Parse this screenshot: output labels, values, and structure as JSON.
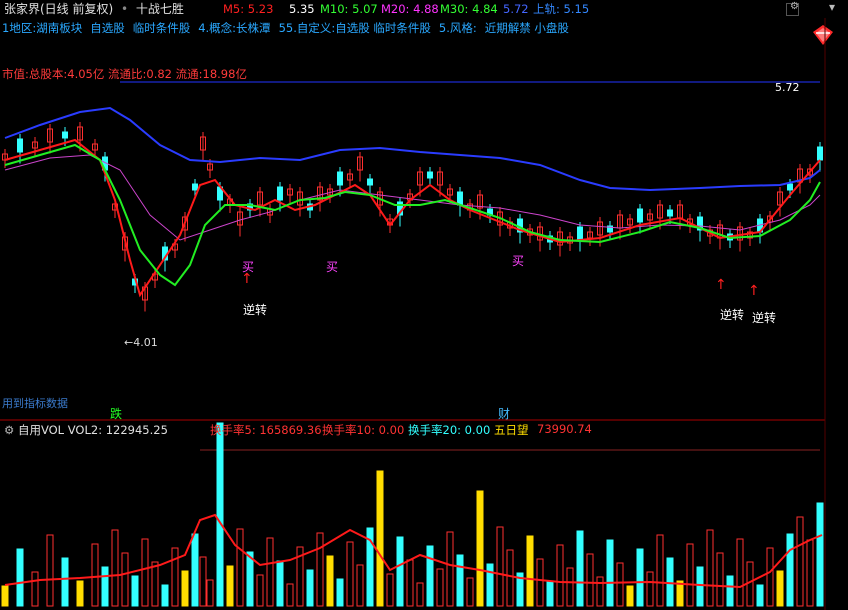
{
  "header": {
    "stock_name": "张家界(日线 前复权)",
    "separator": "•",
    "strategy": "十战七胜"
  },
  "ma": {
    "m5": {
      "label": "M5:",
      "value": "5.23",
      "color": "#ff2020"
    },
    "m5_extra": {
      "value": "5.35",
      "color": "#ffffff"
    },
    "m10": {
      "label": "M10:",
      "value": "5.07",
      "color": "#33ff33"
    },
    "m20": {
      "label": "M20:",
      "value": "4.88",
      "color": "#ff33ff"
    },
    "m30": {
      "label": "M30:",
      "value": "4.84",
      "color": "#33ff33"
    },
    "m30_extra": {
      "value": "5.72",
      "color": "#4466ff"
    },
    "upper": {
      "label": "上轨:",
      "value": "5.15",
      "color": "#3388ff"
    }
  },
  "info": [
    "1地区:湖南板块",
    "自选股",
    "临时条件股",
    "4.概念:长株潭",
    "55.自定义:自选股 临时条件股",
    "5.风格:",
    "近期解禁 小盘股"
  ],
  "cap": "市值:总股本:4.05亿 流通比:0.82 流通:18.98亿",
  "price_labels": {
    "high": "5.72",
    "low": "4.01"
  },
  "annotations": {
    "buy": "买",
    "reverse": "逆转",
    "drop": "跌",
    "fortune": "财",
    "hint": "用到指标数据"
  },
  "volume": {
    "label": "自用VOL",
    "vol2": "VOL2: 122945.25",
    "turn5": "换手率5: 165869.36",
    "turn10": "换手率10: 0.00",
    "turn20": "换手率20: 0.00",
    "five_day": "五日望",
    "five_day_value": "73990.74"
  },
  "chart_data": {
    "type": "candlestick",
    "y_range": [
      4.01,
      5.72
    ],
    "upper_band_label": "5.72",
    "lower_label": "4.01"
  }
}
